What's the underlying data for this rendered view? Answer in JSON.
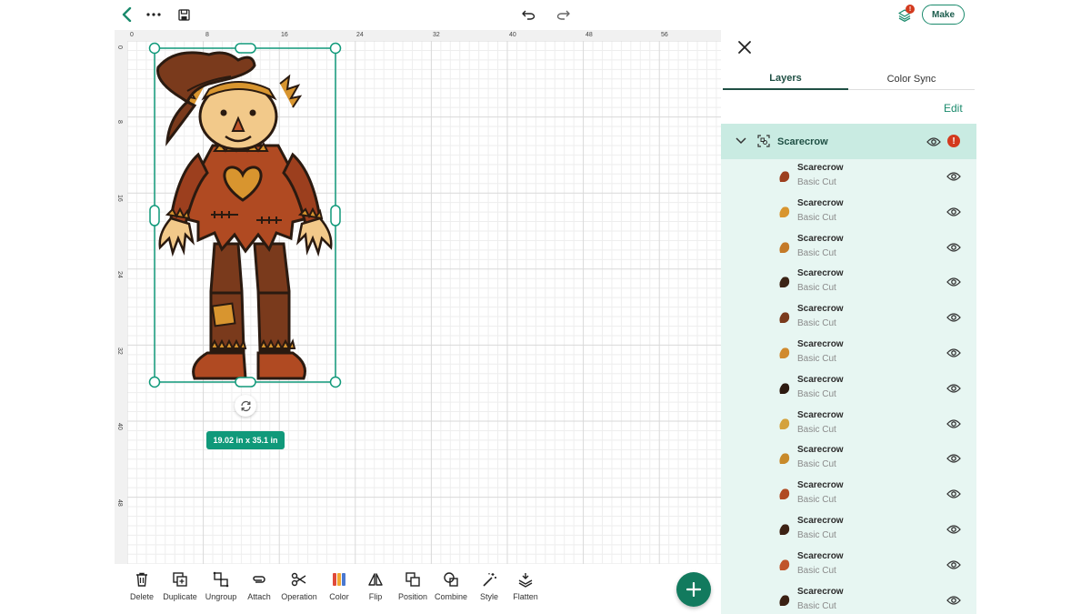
{
  "topbar": {
    "back_icon": "chevron-left-icon",
    "more_icon": "more-horizontal-icon",
    "save_icon": "save-icon",
    "undo_icon": "undo-icon",
    "redo_icon": "redo-icon",
    "layers_icon": "layers-icon",
    "layers_badge": "!",
    "make_label": "Make"
  },
  "canvas": {
    "ruler_top": [
      "0",
      "8",
      "16",
      "24",
      "32",
      "40",
      "48",
      "56"
    ],
    "ruler_left": [
      "0",
      "8",
      "16",
      "24",
      "32",
      "40",
      "48"
    ],
    "size_label": "19.02 in x 35.1 in",
    "accent": "#10997a"
  },
  "toolbar": {
    "tools": [
      {
        "label": "Delete",
        "icon": "trash-icon"
      },
      {
        "label": "Duplicate",
        "icon": "duplicate-icon"
      },
      {
        "label": "Ungroup",
        "icon": "ungroup-icon"
      },
      {
        "label": "Attach",
        "icon": "attach-icon"
      },
      {
        "label": "Operation",
        "icon": "scissors-icon"
      },
      {
        "label": "Color",
        "icon": "color-palette-icon"
      },
      {
        "label": "Flip",
        "icon": "flip-icon"
      },
      {
        "label": "Position",
        "icon": "position-icon"
      },
      {
        "label": "Combine",
        "icon": "combine-icon"
      },
      {
        "label": "Style",
        "icon": "magic-wand-icon"
      },
      {
        "label": "Flatten",
        "icon": "flatten-icon"
      }
    ],
    "fab_icon": "plus-icon"
  },
  "panel": {
    "close_icon": "close-icon",
    "tabs": [
      "Layers",
      "Color Sync"
    ],
    "edit_label": "Edit",
    "group": {
      "name": "Scarecrow",
      "warning": "!"
    },
    "layers": [
      {
        "name": "Scarecrow",
        "type": "Basic Cut",
        "color": "#9c3f1e"
      },
      {
        "name": "Scarecrow",
        "type": "Basic Cut",
        "color": "#d8952f"
      },
      {
        "name": "Scarecrow",
        "type": "Basic Cut",
        "color": "#c47a28"
      },
      {
        "name": "Scarecrow",
        "type": "Basic Cut",
        "color": "#3b2416"
      },
      {
        "name": "Scarecrow",
        "type": "Basic Cut",
        "color": "#7a3a1c"
      },
      {
        "name": "Scarecrow",
        "type": "Basic Cut",
        "color": "#d08a2e"
      },
      {
        "name": "Scarecrow",
        "type": "Basic Cut",
        "color": "#2d1a10"
      },
      {
        "name": "Scarecrow",
        "type": "Basic Cut",
        "color": "#d4a23c"
      },
      {
        "name": "Scarecrow",
        "type": "Basic Cut",
        "color": "#c88a2a"
      },
      {
        "name": "Scarecrow",
        "type": "Basic Cut",
        "color": "#b04a22"
      },
      {
        "name": "Scarecrow",
        "type": "Basic Cut",
        "color": "#3d2214"
      },
      {
        "name": "Scarecrow",
        "type": "Basic Cut",
        "color": "#c0542a"
      },
      {
        "name": "Scarecrow",
        "type": "Basic Cut",
        "color": "#3a2013"
      }
    ]
  }
}
